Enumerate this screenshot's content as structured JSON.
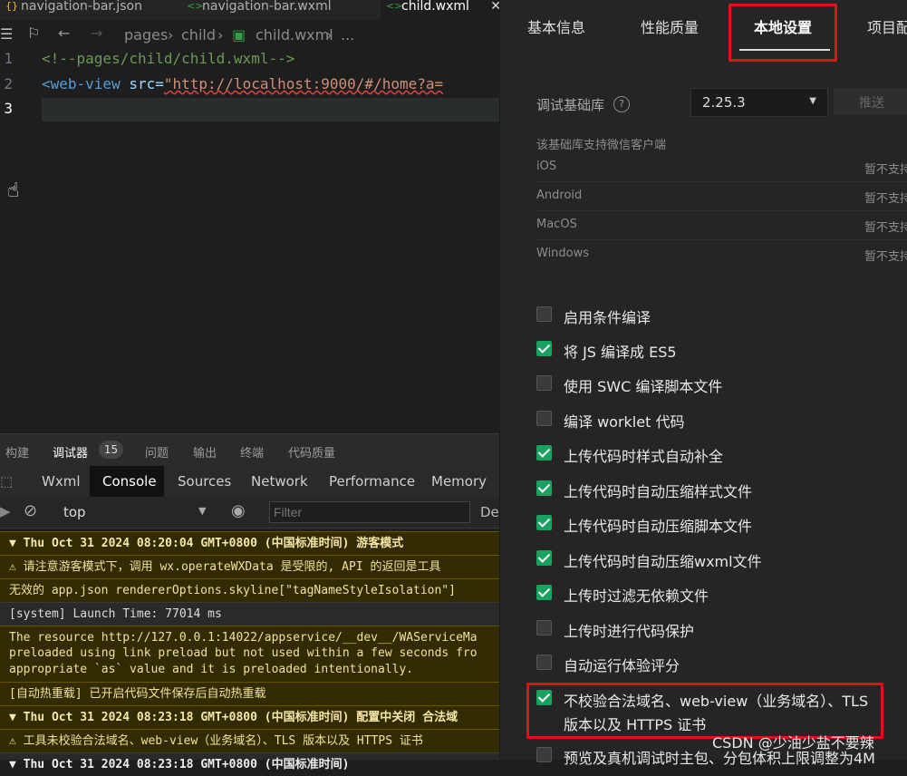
{
  "editor": {
    "tabs": [
      {
        "label": "navigation-bar.json",
        "icon": "json-file-icon"
      },
      {
        "label": "navigation-bar.wxml",
        "icon": "wxml-file-icon"
      },
      {
        "label": "child.wxml",
        "icon": "wxml-file-icon"
      }
    ],
    "breadcrumb": [
      "pages",
      "child",
      "child.wxml",
      "..."
    ],
    "lines": [
      {
        "num": "1",
        "text": "<!--pages/child/child.wxml-->"
      },
      {
        "num": "2",
        "tag": "<web-view",
        "attr": " src=",
        "value": "\"http://localhost:9000/#/home?a="
      },
      {
        "num": "3",
        "text": ""
      }
    ]
  },
  "devtools": {
    "top_tabs": [
      "构建",
      "调试器",
      "问题",
      "输出",
      "终端",
      "代码质量"
    ],
    "badge": "15",
    "panels": [
      "Wxml",
      "Console",
      "Sources",
      "Network",
      "Performance",
      "Memory"
    ],
    "context": "top",
    "filter_placeholder": "Filter",
    "levels": "De",
    "logs": [
      "▼ Thu Oct 31 2024 08:20:04 GMT+0800 (中国标准时间) 游客模式",
      "⚠ 请注意游客模式下，调用 wx.operateWXData 是受限的, API 的返回是工具",
      "无效的 app.json rendererOptions.skyline[\"tagNameStyleIsolation\"]",
      "[system] Launch Time: 77014 ms",
      "The resource http://127.0.0.1:14022/appservice/__dev__/WAServiceMa",
      "preloaded using link preload but not used within a few seconds fro",
      "appropriate `as` value and it is preloaded intentionally.",
      "[自动热重载] 已开启代码文件保存后自动热重载",
      "▼ Thu Oct 31 2024 08:23:18 GMT+0800 (中国标准时间) 配置中关闭 合法域",
      "⚠ 工具未校验合法域名、web-view（业务域名）、TLS 版本以及 HTTPS 证书",
      "▼ Thu Oct 31 2024 08:23:18 GMT+0800 (中国标准时间)"
    ]
  },
  "settings": {
    "tabs": [
      "基本信息",
      "性能质量",
      "本地设置",
      "项目配"
    ],
    "base_lib_label": "调试基础库",
    "base_lib_value": "2.25.3",
    "push_label": "推送",
    "support_title": "该基础库支持微信客户端",
    "platforms": [
      {
        "name": "iOS",
        "status": "暂不支持"
      },
      {
        "name": "Android",
        "status": "暂不支持"
      },
      {
        "name": "MacOS",
        "status": "暂不支持"
      },
      {
        "name": "Windows",
        "status": "暂不支持"
      }
    ],
    "options": [
      {
        "label": "启用条件编译",
        "checked": false
      },
      {
        "label": "将 JS 编译成 ES5",
        "checked": true
      },
      {
        "label": "使用 SWC 编译脚本文件",
        "checked": false
      },
      {
        "label": "编译 worklet 代码",
        "checked": false
      },
      {
        "label": "上传代码时样式自动补全",
        "checked": true
      },
      {
        "label": "上传代码时自动压缩样式文件",
        "checked": true
      },
      {
        "label": "上传代码时自动压缩脚本文件",
        "checked": true
      },
      {
        "label": "上传代码时自动压缩wxml文件",
        "checked": true
      },
      {
        "label": "上传时过滤无依赖文件",
        "checked": true
      },
      {
        "label": "上传时进行代码保护",
        "checked": false
      },
      {
        "label": "自动运行体验评分",
        "checked": false
      },
      {
        "label": "不校验合法域名、web-view（业务域名）、TLS",
        "label2": "版本以及 HTTPS 证书",
        "checked": true
      },
      {
        "label": "预览及真机调试时主包、分包体积上限调整为4M",
        "checked": false
      }
    ]
  },
  "watermark": "CSDN @少油少盐不要辣"
}
